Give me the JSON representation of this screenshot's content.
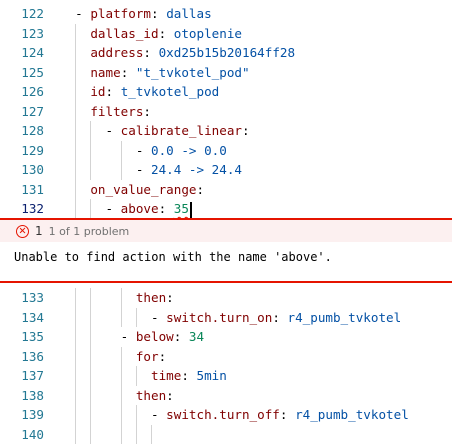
{
  "editor_top": {
    "lines": [
      {
        "num": "122",
        "parts": [
          {
            "t": "  - ",
            "c": "p"
          },
          {
            "t": "platform",
            "c": "k"
          },
          {
            "t": ": ",
            "c": "p"
          },
          {
            "t": "dallas",
            "c": "v"
          }
        ]
      },
      {
        "num": "123",
        "parts": [
          {
            "t": "    ",
            "c": "p"
          },
          {
            "t": "dallas_id",
            "c": "k"
          },
          {
            "t": ": ",
            "c": "p"
          },
          {
            "t": "otoplenie",
            "c": "v"
          }
        ]
      },
      {
        "num": "124",
        "parts": [
          {
            "t": "    ",
            "c": "p"
          },
          {
            "t": "address",
            "c": "k"
          },
          {
            "t": ": ",
            "c": "p"
          },
          {
            "t": "0xd25b15b20164ff28",
            "c": "v"
          }
        ]
      },
      {
        "num": "125",
        "parts": [
          {
            "t": "    ",
            "c": "p"
          },
          {
            "t": "name",
            "c": "k"
          },
          {
            "t": ": ",
            "c": "p"
          },
          {
            "t": "\"t_tvkotel_pod\"",
            "c": "v"
          }
        ]
      },
      {
        "num": "126",
        "parts": [
          {
            "t": "    ",
            "c": "p"
          },
          {
            "t": "id",
            "c": "k"
          },
          {
            "t": ": ",
            "c": "p"
          },
          {
            "t": "t_tvkotel_pod",
            "c": "v"
          }
        ]
      },
      {
        "num": "127",
        "parts": [
          {
            "t": "    ",
            "c": "p"
          },
          {
            "t": "filters",
            "c": "k"
          },
          {
            "t": ":",
            "c": "p"
          }
        ]
      },
      {
        "num": "128",
        "parts": [
          {
            "t": "      - ",
            "c": "p"
          },
          {
            "t": "calibrate_linear",
            "c": "k"
          },
          {
            "t": ":",
            "c": "p"
          }
        ]
      },
      {
        "num": "129",
        "parts": [
          {
            "t": "          - ",
            "c": "p"
          },
          {
            "t": "0.0 -> 0.0",
            "c": "v"
          }
        ]
      },
      {
        "num": "130",
        "parts": [
          {
            "t": "          - ",
            "c": "p"
          },
          {
            "t": "24.4 -> 24.4",
            "c": "v"
          }
        ]
      },
      {
        "num": "131",
        "parts": [
          {
            "t": "    ",
            "c": "p"
          },
          {
            "t": "on_value_range",
            "c": "k"
          },
          {
            "t": ":",
            "c": "p"
          }
        ]
      },
      {
        "num": "132",
        "active": true,
        "parts": [
          {
            "t": "      - ",
            "c": "p"
          },
          {
            "t": "above",
            "c": "k"
          },
          {
            "t": ": ",
            "c": "p"
          },
          {
            "t": "35",
            "c": "n",
            "squiggle": true
          }
        ]
      }
    ]
  },
  "problem_peek": {
    "count": "1",
    "title": "1 of 1 problem",
    "message": "Unable to find action with the name 'above'."
  },
  "editor_bottom": {
    "lines": [
      {
        "num": "133",
        "parts": [
          {
            "t": "          ",
            "c": "p"
          },
          {
            "t": "then",
            "c": "k"
          },
          {
            "t": ":",
            "c": "p"
          }
        ]
      },
      {
        "num": "134",
        "parts": [
          {
            "t": "            - ",
            "c": "p"
          },
          {
            "t": "switch.turn_on",
            "c": "k"
          },
          {
            "t": ": ",
            "c": "p"
          },
          {
            "t": "r4_pumb_tvkotel",
            "c": "v"
          }
        ]
      },
      {
        "num": "135",
        "parts": [
          {
            "t": "        - ",
            "c": "p"
          },
          {
            "t": "below",
            "c": "k"
          },
          {
            "t": ": ",
            "c": "p"
          },
          {
            "t": "34",
            "c": "n"
          }
        ]
      },
      {
        "num": "136",
        "parts": [
          {
            "t": "          ",
            "c": "p"
          },
          {
            "t": "for",
            "c": "k"
          },
          {
            "t": ":",
            "c": "p"
          }
        ]
      },
      {
        "num": "137",
        "parts": [
          {
            "t": "            ",
            "c": "p"
          },
          {
            "t": "time",
            "c": "k"
          },
          {
            "t": ": ",
            "c": "p"
          },
          {
            "t": "5min",
            "c": "v"
          }
        ]
      },
      {
        "num": "138",
        "parts": [
          {
            "t": "          ",
            "c": "p"
          },
          {
            "t": "then",
            "c": "k"
          },
          {
            "t": ":",
            "c": "p"
          }
        ]
      },
      {
        "num": "139",
        "parts": [
          {
            "t": "            - ",
            "c": "p"
          },
          {
            "t": "switch.turn_off",
            "c": "k"
          },
          {
            "t": ": ",
            "c": "p"
          },
          {
            "t": "r4_pumb_tvkotel",
            "c": "v"
          }
        ]
      },
      {
        "num": "140",
        "parts": []
      }
    ]
  },
  "colors": {
    "error": "#e51400",
    "key": "#800000",
    "value": "#0451a5",
    "number": "#098658",
    "line_number": "#237893"
  }
}
